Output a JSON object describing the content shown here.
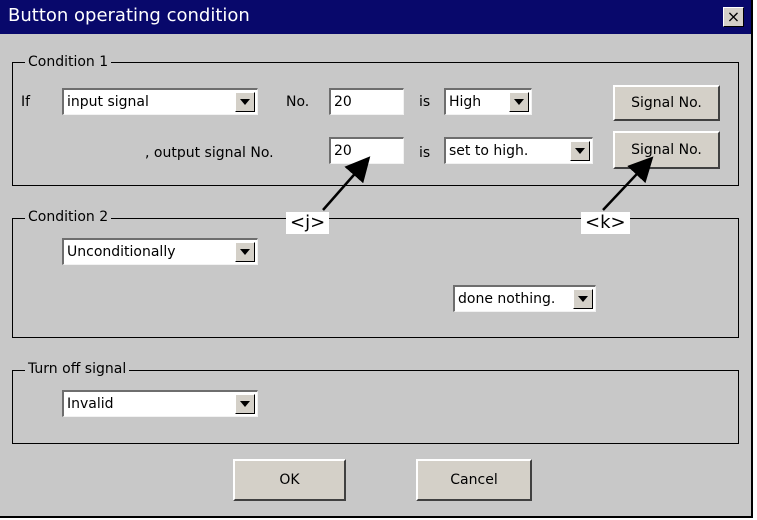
{
  "dialog": {
    "title": "Button operating condition",
    "close_label": "×"
  },
  "condition1": {
    "legend": "Condition 1",
    "if_label": "If",
    "source_value": "input signal",
    "no_label": "No.",
    "input_no_value": "20",
    "is_label": "is",
    "state_value": "High",
    "output_label": ", output signal No.",
    "output_no_value": "20",
    "is_label2": "is",
    "action_value": "set to high.",
    "signal_no_button_1": "Signal No.",
    "signal_no_button_2": "Signal No."
  },
  "condition2": {
    "legend": "Condition 2",
    "mode_value": "Unconditionally",
    "result_value": "done nothing."
  },
  "turn_off": {
    "legend": "Turn off signal",
    "value": "Invalid"
  },
  "buttons": {
    "ok_label": "OK",
    "cancel_label": "Cancel"
  },
  "annotations": {
    "j": "<j>",
    "k": "<k>"
  }
}
